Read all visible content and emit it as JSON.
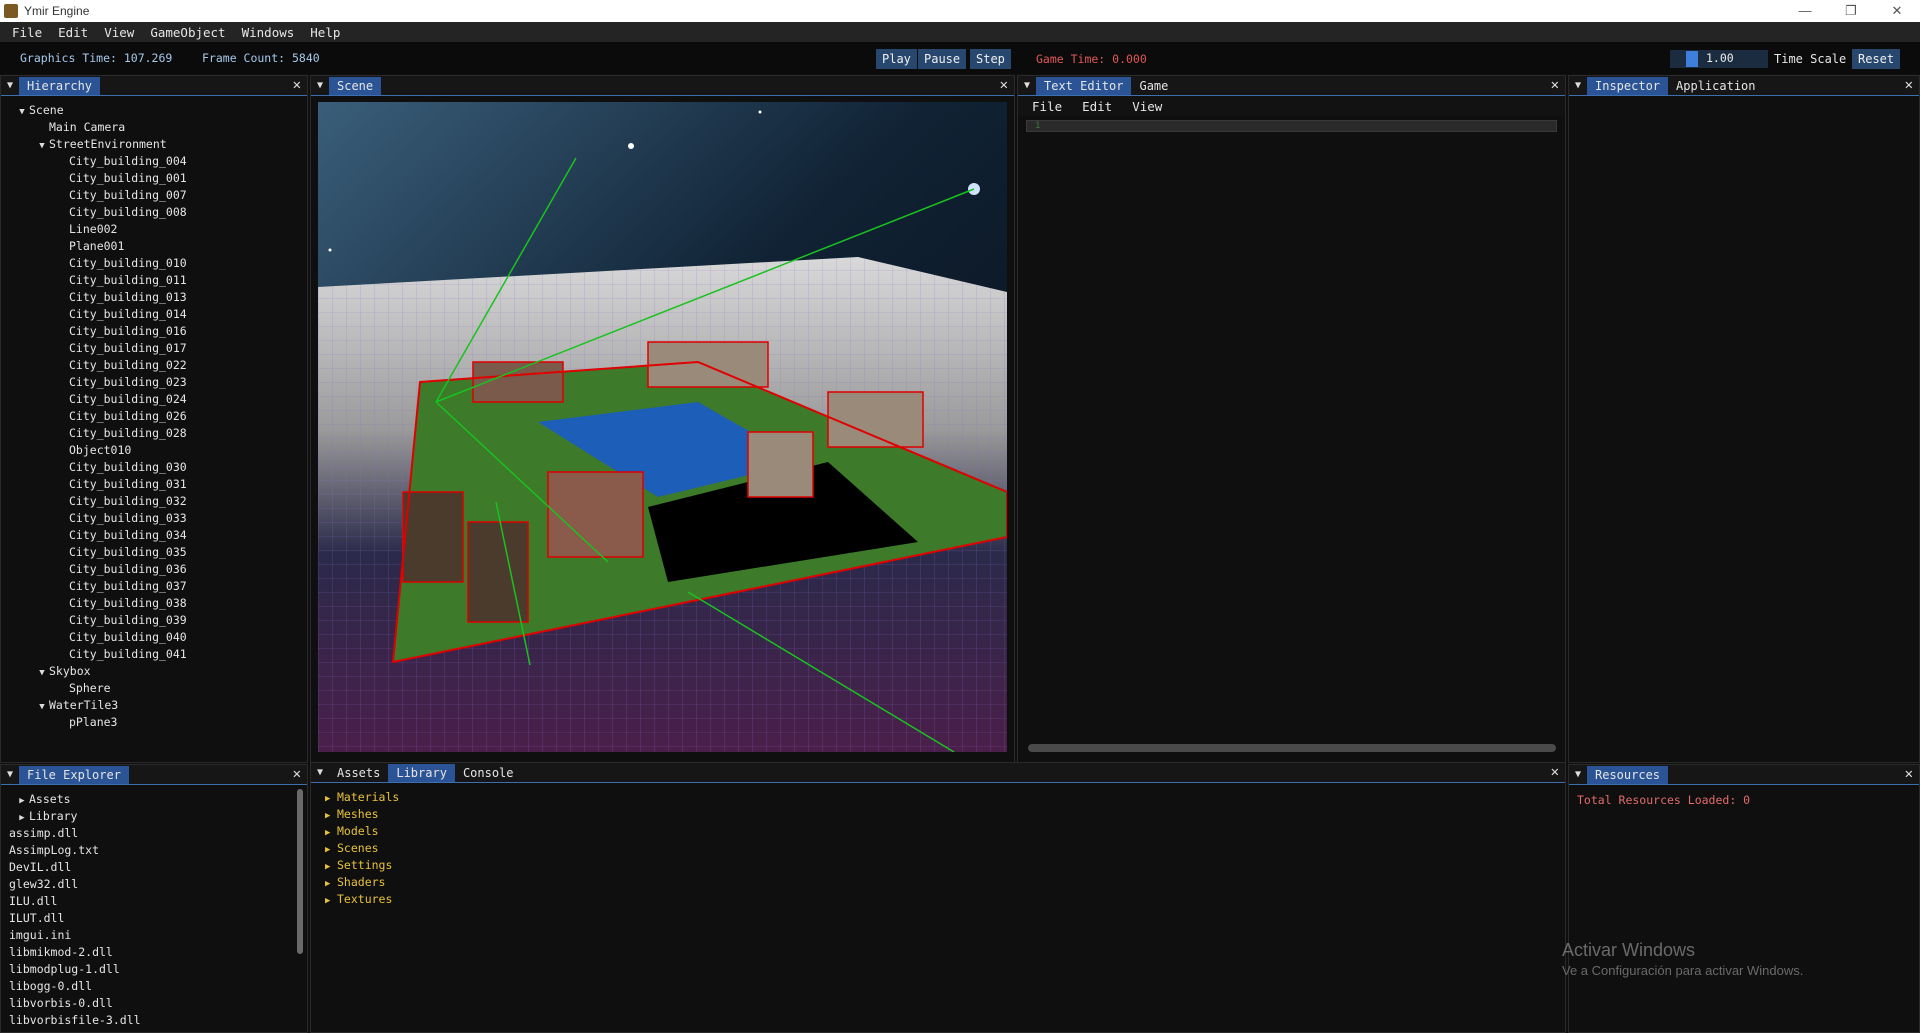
{
  "window": {
    "title": "Ymir Engine",
    "controls": [
      "—",
      "❐",
      "✕"
    ]
  },
  "menu": [
    "File",
    "Edit",
    "View",
    "GameObject",
    "Windows",
    "Help"
  ],
  "toolbar": {
    "graphics_time": "Graphics Time: 107.269",
    "frame_count": "Frame Count: 5840",
    "play": "Play",
    "pause": "Pause",
    "step": "Step",
    "game_time": "Game Time: 0.000",
    "time_scale_value": "1.00",
    "time_scale_label": "Time Scale",
    "reset": "Reset"
  },
  "hierarchy": {
    "tab": "Hierarchy",
    "rows": [
      {
        "label": "Scene",
        "arrow": "▼"
      },
      {
        "label": "Main Camera",
        "arrow": ""
      },
      {
        "label": "StreetEnvironment",
        "arrow": "▼"
      },
      {
        "label": "City_building_004",
        "arrow": ""
      },
      {
        "label": "City_building_001",
        "arrow": ""
      },
      {
        "label": "City_building_007",
        "arrow": ""
      },
      {
        "label": "City_building_008",
        "arrow": ""
      },
      {
        "label": "Line002",
        "arrow": ""
      },
      {
        "label": "Plane001",
        "arrow": ""
      },
      {
        "label": "City_building_010",
        "arrow": ""
      },
      {
        "label": "City_building_011",
        "arrow": ""
      },
      {
        "label": "City_building_013",
        "arrow": ""
      },
      {
        "label": "City_building_014",
        "arrow": ""
      },
      {
        "label": "City_building_016",
        "arrow": ""
      },
      {
        "label": "City_building_017",
        "arrow": ""
      },
      {
        "label": "City_building_022",
        "arrow": ""
      },
      {
        "label": "City_building_023",
        "arrow": ""
      },
      {
        "label": "City_building_024",
        "arrow": ""
      },
      {
        "label": "City_building_026",
        "arrow": ""
      },
      {
        "label": "City_building_028",
        "arrow": ""
      },
      {
        "label": "Object010",
        "arrow": ""
      },
      {
        "label": "City_building_030",
        "arrow": ""
      },
      {
        "label": "City_building_031",
        "arrow": ""
      },
      {
        "label": "City_building_032",
        "arrow": ""
      },
      {
        "label": "City_building_033",
        "arrow": ""
      },
      {
        "label": "City_building_034",
        "arrow": ""
      },
      {
        "label": "City_building_035",
        "arrow": ""
      },
      {
        "label": "City_building_036",
        "arrow": ""
      },
      {
        "label": "City_building_037",
        "arrow": ""
      },
      {
        "label": "City_building_038",
        "arrow": ""
      },
      {
        "label": "City_building_039",
        "arrow": ""
      },
      {
        "label": "City_building_040",
        "arrow": ""
      },
      {
        "label": "City_building_041",
        "arrow": ""
      },
      {
        "label": "Skybox",
        "arrow": "▼"
      },
      {
        "label": "Sphere",
        "arrow": ""
      },
      {
        "label": "WaterTile3",
        "arrow": "▼"
      },
      {
        "label": "pPlane3",
        "arrow": ""
      }
    ]
  },
  "scene": {
    "tab": "Scene"
  },
  "text_editor": {
    "tabs": [
      "Text Editor",
      "Game"
    ],
    "menu": [
      "File",
      "Edit",
      "View"
    ],
    "line_number": "1"
  },
  "inspector": {
    "tabs": [
      "Inspector",
      "Application"
    ]
  },
  "file_explorer": {
    "tab": "File Explorer",
    "folders": [
      "Assets",
      "Library"
    ],
    "files": [
      "assimp.dll",
      "AssimpLog.txt",
      "DevIL.dll",
      "glew32.dll",
      "ILU.dll",
      "ILUT.dll",
      "imgui.ini",
      "libmikmod-2.dll",
      "libmodplug-1.dll",
      "libogg-0.dll",
      "libvorbis-0.dll",
      "libvorbisfile-3.dll"
    ]
  },
  "bottom_center": {
    "tabs": [
      "Assets",
      "Library",
      "Console"
    ],
    "folders": [
      "Materials",
      "Meshes",
      "Models",
      "Scenes",
      "Settings",
      "Shaders",
      "Textures"
    ]
  },
  "resources": {
    "tab": "Resources",
    "text": "Total Resources Loaded: 0"
  },
  "watermark": {
    "line1": "Activar Windows",
    "line2": "Ve a Configuración para activar Windows."
  },
  "colors": {
    "accent": "#2a5496",
    "button": "#27476e",
    "folder": "#e8c23a",
    "warning": "#e36b6b"
  }
}
